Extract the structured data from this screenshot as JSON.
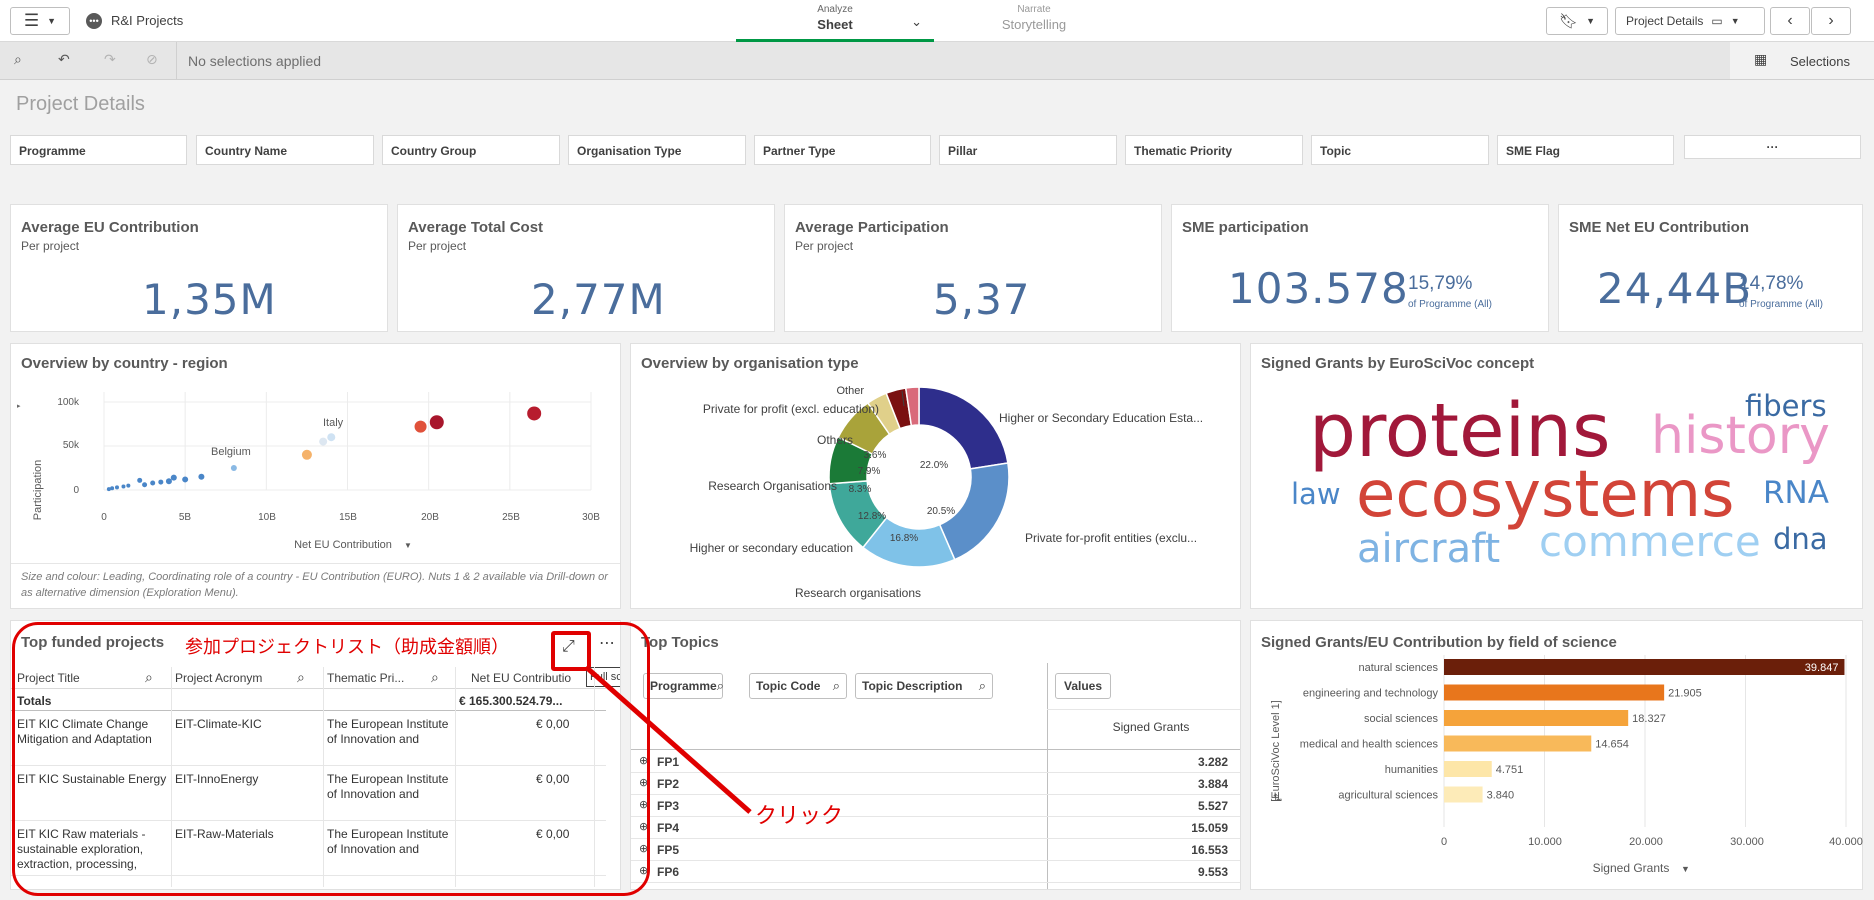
{
  "app": {
    "title": "R&I Projects"
  },
  "header": {
    "tabs": [
      {
        "small": "Analyze",
        "label": "Sheet"
      },
      {
        "small": "Narrate",
        "label": "Storytelling"
      }
    ],
    "sheet_name": "Project Details"
  },
  "selections": {
    "status": "No selections applied",
    "button": "Selections"
  },
  "page": {
    "title": "Project Details"
  },
  "filters": [
    "Programme",
    "Country Name",
    "Country Group",
    "Organisation Type",
    "Partner Type",
    "Pillar",
    "Thematic Priority",
    "Topic",
    "SME Flag"
  ],
  "filters_more": "···",
  "kpis": [
    {
      "title": "Average EU Contribution",
      "sub": "Per project",
      "value": "1,35M"
    },
    {
      "title": "Average Total Cost",
      "sub": "Per project",
      "value": "2,77M"
    },
    {
      "title": "Average Participation",
      "sub": "Per project",
      "value": "5,37"
    },
    {
      "title": "SME participation",
      "sub": "",
      "value": "103.578",
      "pct": "15,79%",
      "pct_sub": "of Programme (All)"
    },
    {
      "title": "SME Net EU Contribution",
      "sub": "",
      "value": "24,44B",
      "pct": "14,78%",
      "pct_sub": "of Programme (All)"
    }
  ],
  "scatter": {
    "title": "Overview by country - region",
    "ylabel": "Participation",
    "xlabel": "Net EU Contribution",
    "yticks": [
      "100k",
      "50k",
      "0"
    ],
    "xticks": [
      "0",
      "5B",
      "10B",
      "15B",
      "20B",
      "25B",
      "30B"
    ],
    "labels": [
      "Italy",
      "Belgium"
    ],
    "note": "Size and colour: Leading, Coordinating role of a country - EU Contribution (EURO). Nuts 1 & 2 available via Drill-down or as alternative dimension (Exploration Menu)."
  },
  "donut": {
    "title": "Overview by organisation type",
    "labels": [
      "Other",
      "Private for profit (excl. education)",
      "Others",
      "Research Organisations",
      "Higher or secondary education",
      "Research organisations",
      "Higher or Secondary Education Esta...",
      "Private for-profit entities (exclu..."
    ],
    "pcts": [
      "3.6%",
      "7.9%",
      "8.3%",
      "12.8%",
      "16.8%",
      "20.5%",
      "22.0%"
    ]
  },
  "wordcloud": {
    "title": "Signed Grants by EuroSciVoc concept",
    "words": [
      "proteins",
      "history",
      "fibers",
      "law",
      "ecosystems",
      "RNA",
      "aircraft",
      "commerce",
      "dna"
    ]
  },
  "top_projects": {
    "title": "Top funded projects",
    "annotation": "参加プロジェクトリスト（助成金額順）",
    "tooltip": "Full screen",
    "columns": [
      "Project Title",
      "Project Acronym",
      "Thematic Pri...",
      "Net EU Contributio"
    ],
    "totals_label": "Totals",
    "totals_value": "€ 165.300.524.79...",
    "rows": [
      {
        "title": "EIT KIC Climate Change Mitigation and Adaptation",
        "acronym": "EIT-Climate-KIC",
        "theme": "The European Institute of Innovation and",
        "value": "€ 0,00"
      },
      {
        "title": "EIT KIC Sustainable Energy",
        "acronym": "EIT-InnoEnergy",
        "theme": "The European Institute of Innovation and",
        "value": "€ 0,00"
      },
      {
        "title": "EIT KIC Raw materials - sustainable exploration, extraction, processing,",
        "acronym": "EIT-Raw-Materials",
        "theme": "The European Institute of Innovation and",
        "value": "€ 0,00"
      }
    ]
  },
  "click_label": "クリック",
  "top_topics": {
    "title": "Top Topics",
    "filters": [
      "Programme",
      "Topic Code",
      "Topic Description"
    ],
    "values_btn": "Values",
    "col": "Signed Grants",
    "rows": [
      {
        "name": "FP1",
        "value": "3.282"
      },
      {
        "name": "FP2",
        "value": "3.884"
      },
      {
        "name": "FP3",
        "value": "5.527"
      },
      {
        "name": "FP4",
        "value": "15.059"
      },
      {
        "name": "FP5",
        "value": "16.553"
      },
      {
        "name": "FP6",
        "value": "9.553"
      }
    ]
  },
  "field_chart": {
    "title": "Signed Grants/EU Contribution by field of science",
    "ylabel": "[EuroSciVoc Level 1]",
    "xlabel": "Signed Grants",
    "xticks": [
      "0",
      "10.000",
      "20.000",
      "30.000",
      "40.000"
    ]
  },
  "chart_data": [
    {
      "type": "bar",
      "title": "Signed Grants/EU Contribution by field of science",
      "xlabel": "Signed Grants",
      "ylabel": "[EuroSciVoc Level 1]",
      "categories": [
        "natural sciences",
        "engineering and technology",
        "social sciences",
        "medical and health sciences",
        "humanities",
        "agricultural sciences"
      ],
      "values": [
        39847,
        21905,
        18327,
        14654,
        4751,
        3840
      ],
      "labels": [
        "39.847",
        "21.905",
        "18.327",
        "14.654",
        "4.751",
        "3.840"
      ],
      "colors": [
        "#6b1f0a",
        "#e8761c",
        "#f5a33a",
        "#f8b95a",
        "#fde6a8",
        "#fdebb8"
      ],
      "xlim": [
        0,
        40000
      ]
    },
    {
      "type": "pie",
      "title": "Overview by organisation type",
      "values": [
        22.0,
        20.5,
        16.8,
        12.8,
        8.3,
        7.9,
        3.6,
        3.5,
        2.3
      ],
      "colors": [
        "#2e2e8c",
        "#5b8fc9",
        "#7fc2e8",
        "#3fa89a",
        "#1b7a37",
        "#a9a33a",
        "#e0d08a",
        "#7a1010",
        "#d96a7a"
      ]
    },
    {
      "type": "scatter",
      "title": "Overview by country - region",
      "xlabel": "Net EU Contribution",
      "ylabel": "Participation",
      "xlim": [
        0,
        30
      ],
      "ylim": [
        0,
        100
      ],
      "points": [
        {
          "x": 26.5,
          "y": 87,
          "r": 7,
          "color": "#b71c2e"
        },
        {
          "x": 20.5,
          "y": 77,
          "r": 7,
          "color": "#a8162c"
        },
        {
          "x": 19.5,
          "y": 72,
          "r": 6,
          "color": "#e0513a"
        },
        {
          "x": 14,
          "y": 60,
          "r": 4,
          "color": "#cfe2f3"
        },
        {
          "x": 13.5,
          "y": 55,
          "r": 4,
          "color": "#dde7f1"
        },
        {
          "x": 12.5,
          "y": 40,
          "r": 5,
          "color": "#f5b26a"
        },
        {
          "x": 8,
          "y": 25,
          "r": 3,
          "color": "#8ab9e4"
        },
        {
          "x": 6,
          "y": 15,
          "r": 3,
          "color": "#4a86c8"
        },
        {
          "x": 5,
          "y": 12,
          "r": 3,
          "color": "#4a86c8"
        },
        {
          "x": 4.3,
          "y": 14,
          "r": 3,
          "color": "#4a86c8"
        },
        {
          "x": 4,
          "y": 10,
          "r": 3,
          "color": "#4a86c8"
        },
        {
          "x": 3.5,
          "y": 9,
          "r": 2.5,
          "color": "#4a86c8"
        },
        {
          "x": 3,
          "y": 8,
          "r": 2.5,
          "color": "#4a86c8"
        },
        {
          "x": 2.5,
          "y": 6,
          "r": 2.5,
          "color": "#4a86c8"
        },
        {
          "x": 2.2,
          "y": 11,
          "r": 2.5,
          "color": "#4a86c8"
        },
        {
          "x": 1.5,
          "y": 5,
          "r": 2,
          "color": "#4a86c8"
        },
        {
          "x": 1.2,
          "y": 4,
          "r": 2,
          "color": "#4a86c8"
        },
        {
          "x": 0.8,
          "y": 3,
          "r": 2,
          "color": "#4a86c8"
        },
        {
          "x": 0.5,
          "y": 2,
          "r": 2,
          "color": "#4a86c8"
        },
        {
          "x": 0.3,
          "y": 1,
          "r": 2,
          "color": "#4a86c8"
        }
      ]
    }
  ]
}
